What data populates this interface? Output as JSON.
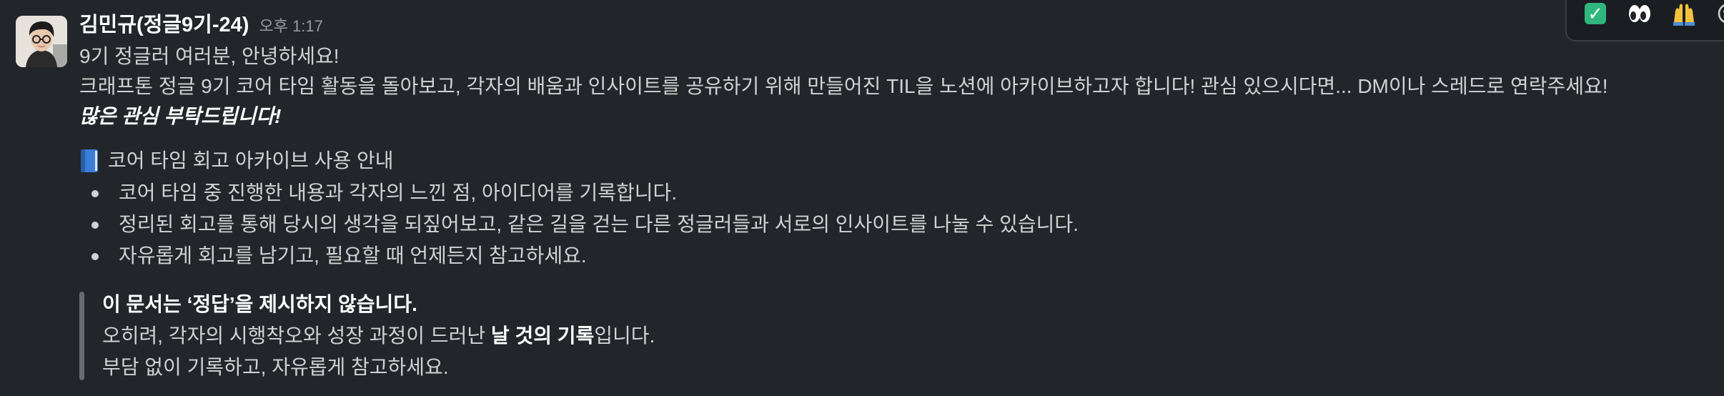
{
  "message": {
    "author": "김민규(정글9기-24)",
    "time": "오후 1:17",
    "greeting": "9기 정글러 여러분, 안녕하세요!",
    "intro": "크래프톤 정글 9기 코어 타임 활동을 돌아보고, 각자의 배움과 인사이트를 공유하기 위해 만들어진 TIL을 노션에 아카이브하고자 합니다! 관심 있으시다면... DM이나 스레드로 연락주세요!",
    "emphasis": "많은 관심 부탁드립니다!",
    "section_title": "코어 타임 회고 아카이브 사용 안내",
    "section_icon": "blue-book-icon",
    "bullets": [
      "코어 타임 중 진행한 내용과 각자의 느낀 점, 아이디어를 기록합니다.",
      "정리된 회고를 통해 당시의 생각을 되짚어보고, 같은 길을 걷는 다른 정글러들과 서로의 인사이트를 나눌 수 있습니다.",
      "자유롭게 회고를 남기고, 필요할 때 언제든지 참고하세요."
    ],
    "quote": {
      "line1": "이 문서는 ‘정답’을 제시하지 않습니다.",
      "line2_before": "오히려, 각자의 시행착오와 성장 과정이 드러난 ",
      "line2_bold": "날 것의 기록",
      "line2_after": "입니다.",
      "line3": "부담 없이 기록하고, 자유롭게 참고하세요."
    }
  },
  "reactions": {
    "items": [
      "check-mark-icon",
      "eyes-icon",
      "raised-hands-icon",
      "add-reaction-icon"
    ]
  },
  "colors": {
    "background": "#222529",
    "text": "#d1d2d3",
    "author": "#ffffff",
    "timestamp": "#9a9b9e",
    "quote_bar": "#6a6b6e",
    "check_green": "#2eb67d"
  }
}
